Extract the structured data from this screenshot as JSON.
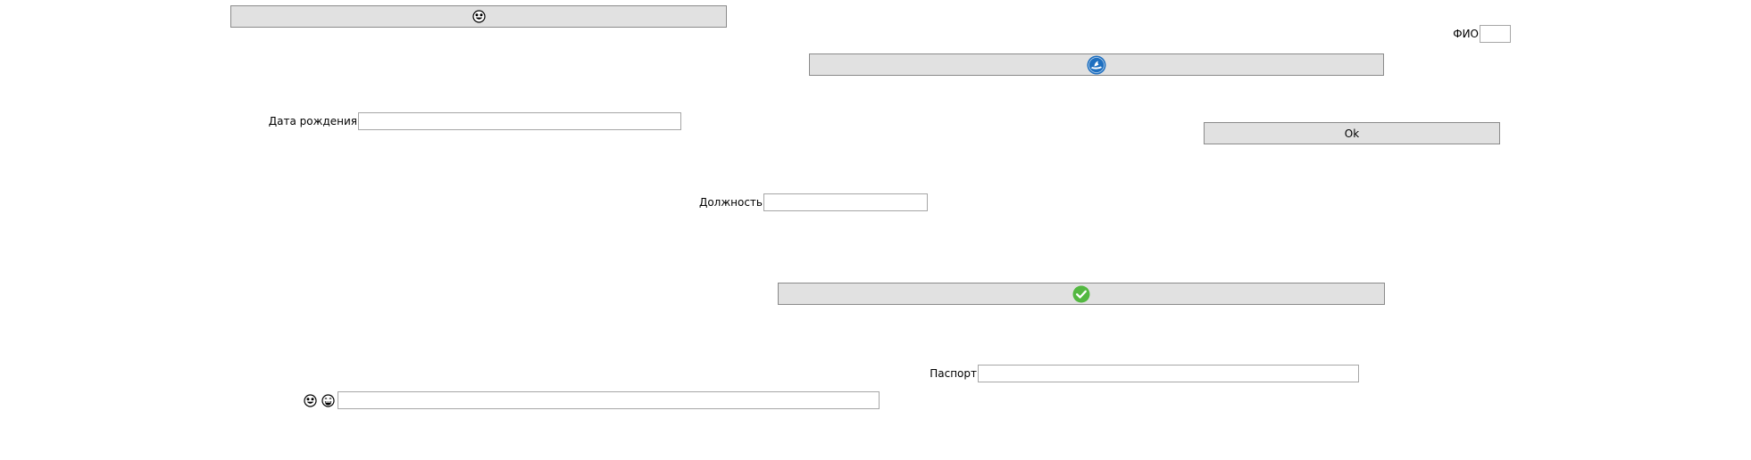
{
  "icons": {
    "top_button": "smiley-face-icon",
    "second_button": "blue-dolphin-icon",
    "check_button": "green-check-circle-icon",
    "bottom_left_1": "smiley-face-icon",
    "bottom_left_2": "grinning-face-icon"
  },
  "colors": {
    "button_bg": "#e1e1e1",
    "button_border": "#8a8a8a",
    "field_border": "#a6a6a6",
    "dolphin_blue": "#1e6fc0",
    "check_green": "#53b841"
  },
  "form": {
    "fio_label": "ФИО",
    "fio_value": "",
    "birthdate_label": "Дата рождения",
    "birthdate_value": "",
    "position_label": "Должность",
    "position_value": "",
    "passport_label": "Паспорт",
    "passport_value": "",
    "bottom_field_value": ""
  },
  "buttons": {
    "ok_label": "Ok"
  }
}
